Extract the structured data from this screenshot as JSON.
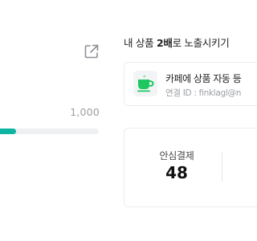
{
  "progress": {
    "max_label": "1,000",
    "fill_fraction": 0.02,
    "fill_color": "#0fb5a3"
  },
  "external_link": {
    "icon": "external-link-icon"
  },
  "section": {
    "title_part1": "내 상품 ",
    "title_bold": "2배",
    "title_part2": "로 노출시키기"
  },
  "cafe_link": {
    "icon": "coffee-cup-icon",
    "icon_color": "#1ec760",
    "name": "카페에 상품 자동 등",
    "account": "연결 ID : finklagl@n"
  },
  "stats": [
    {
      "label": "안심결제",
      "value": "48"
    }
  ]
}
